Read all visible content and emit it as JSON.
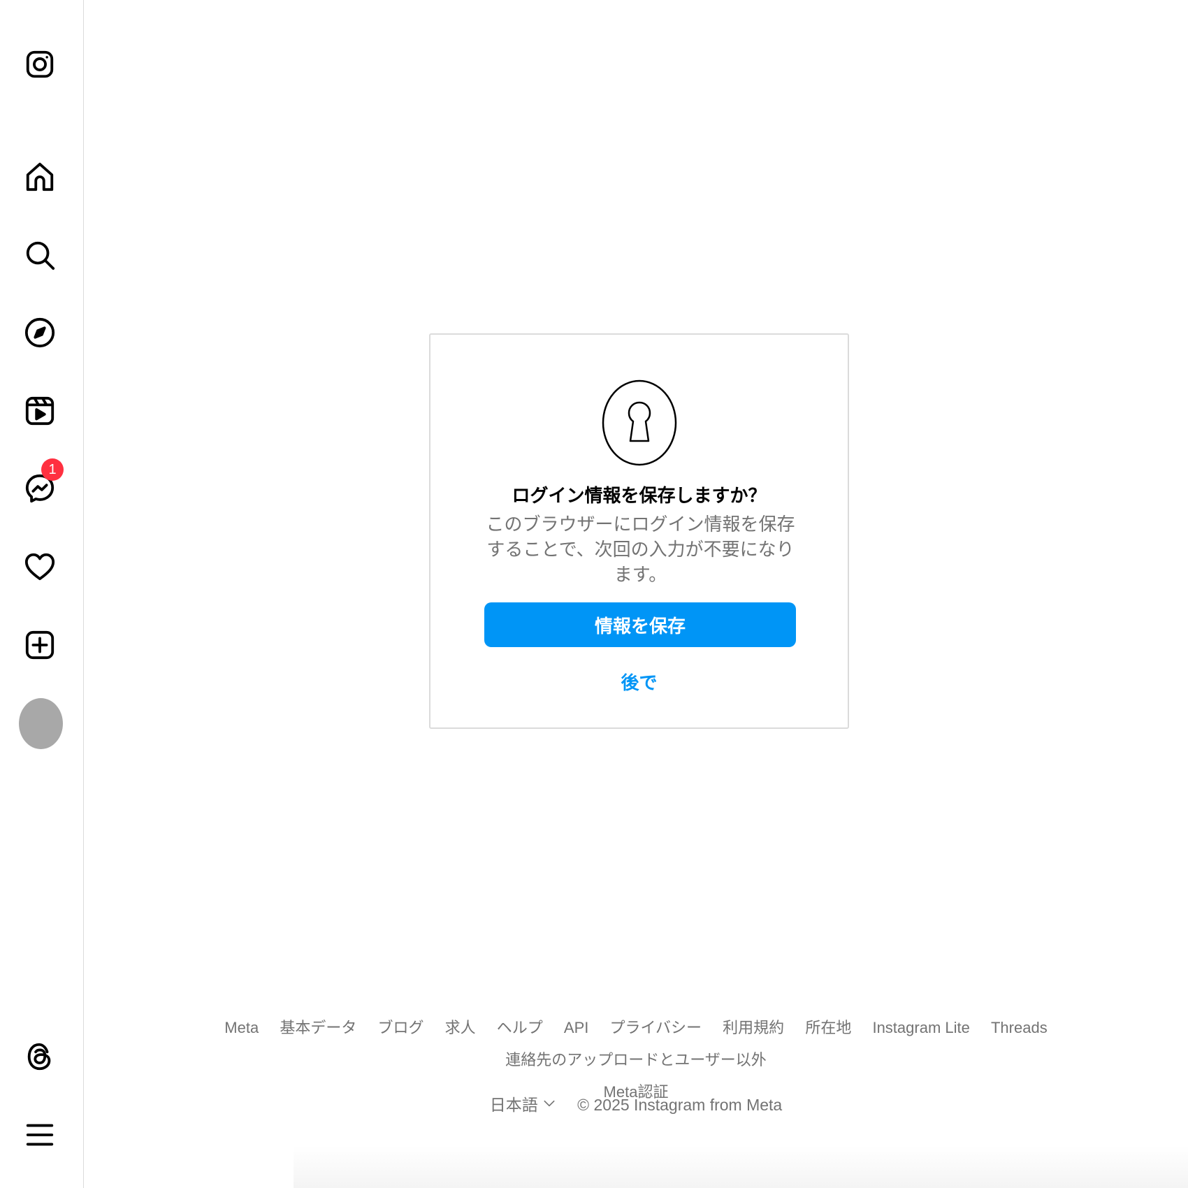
{
  "sidebar": {
    "items": [
      {
        "name": "home",
        "icon": "home-icon"
      },
      {
        "name": "search",
        "icon": "search-icon"
      },
      {
        "name": "explore",
        "icon": "compass-icon"
      },
      {
        "name": "reels",
        "icon": "reels-icon"
      },
      {
        "name": "messages",
        "icon": "messenger-icon",
        "badge": "1"
      },
      {
        "name": "notifications",
        "icon": "heart-icon"
      },
      {
        "name": "create",
        "icon": "plus-square-icon"
      }
    ],
    "bottom": [
      {
        "name": "threads",
        "icon": "threads-icon"
      },
      {
        "name": "more",
        "icon": "menu-icon"
      }
    ]
  },
  "dialog": {
    "icon": "keyhole-icon",
    "title": "ログイン情報を保存しますか？",
    "description": "このブラウザーにログイン情報を保存することで、次回の入力が不要になります。",
    "save_label": "情報を保存",
    "later_label": "後で"
  },
  "footer": {
    "links": [
      "Meta",
      "基本データ",
      "ブログ",
      "求人",
      "ヘルプ",
      "API",
      "プライバシー",
      "利用規約",
      "所在地",
      "Instagram Lite",
      "Threads",
      "連絡先のアップロードとユーザー以外",
      "Meta認証"
    ],
    "language": "日本語",
    "copyright": "© 2025 Instagram from Meta"
  },
  "colors": {
    "accent": "#0095f6",
    "badge": "#ff3040",
    "secondary_text": "#737373",
    "border": "#dbdbdb"
  }
}
